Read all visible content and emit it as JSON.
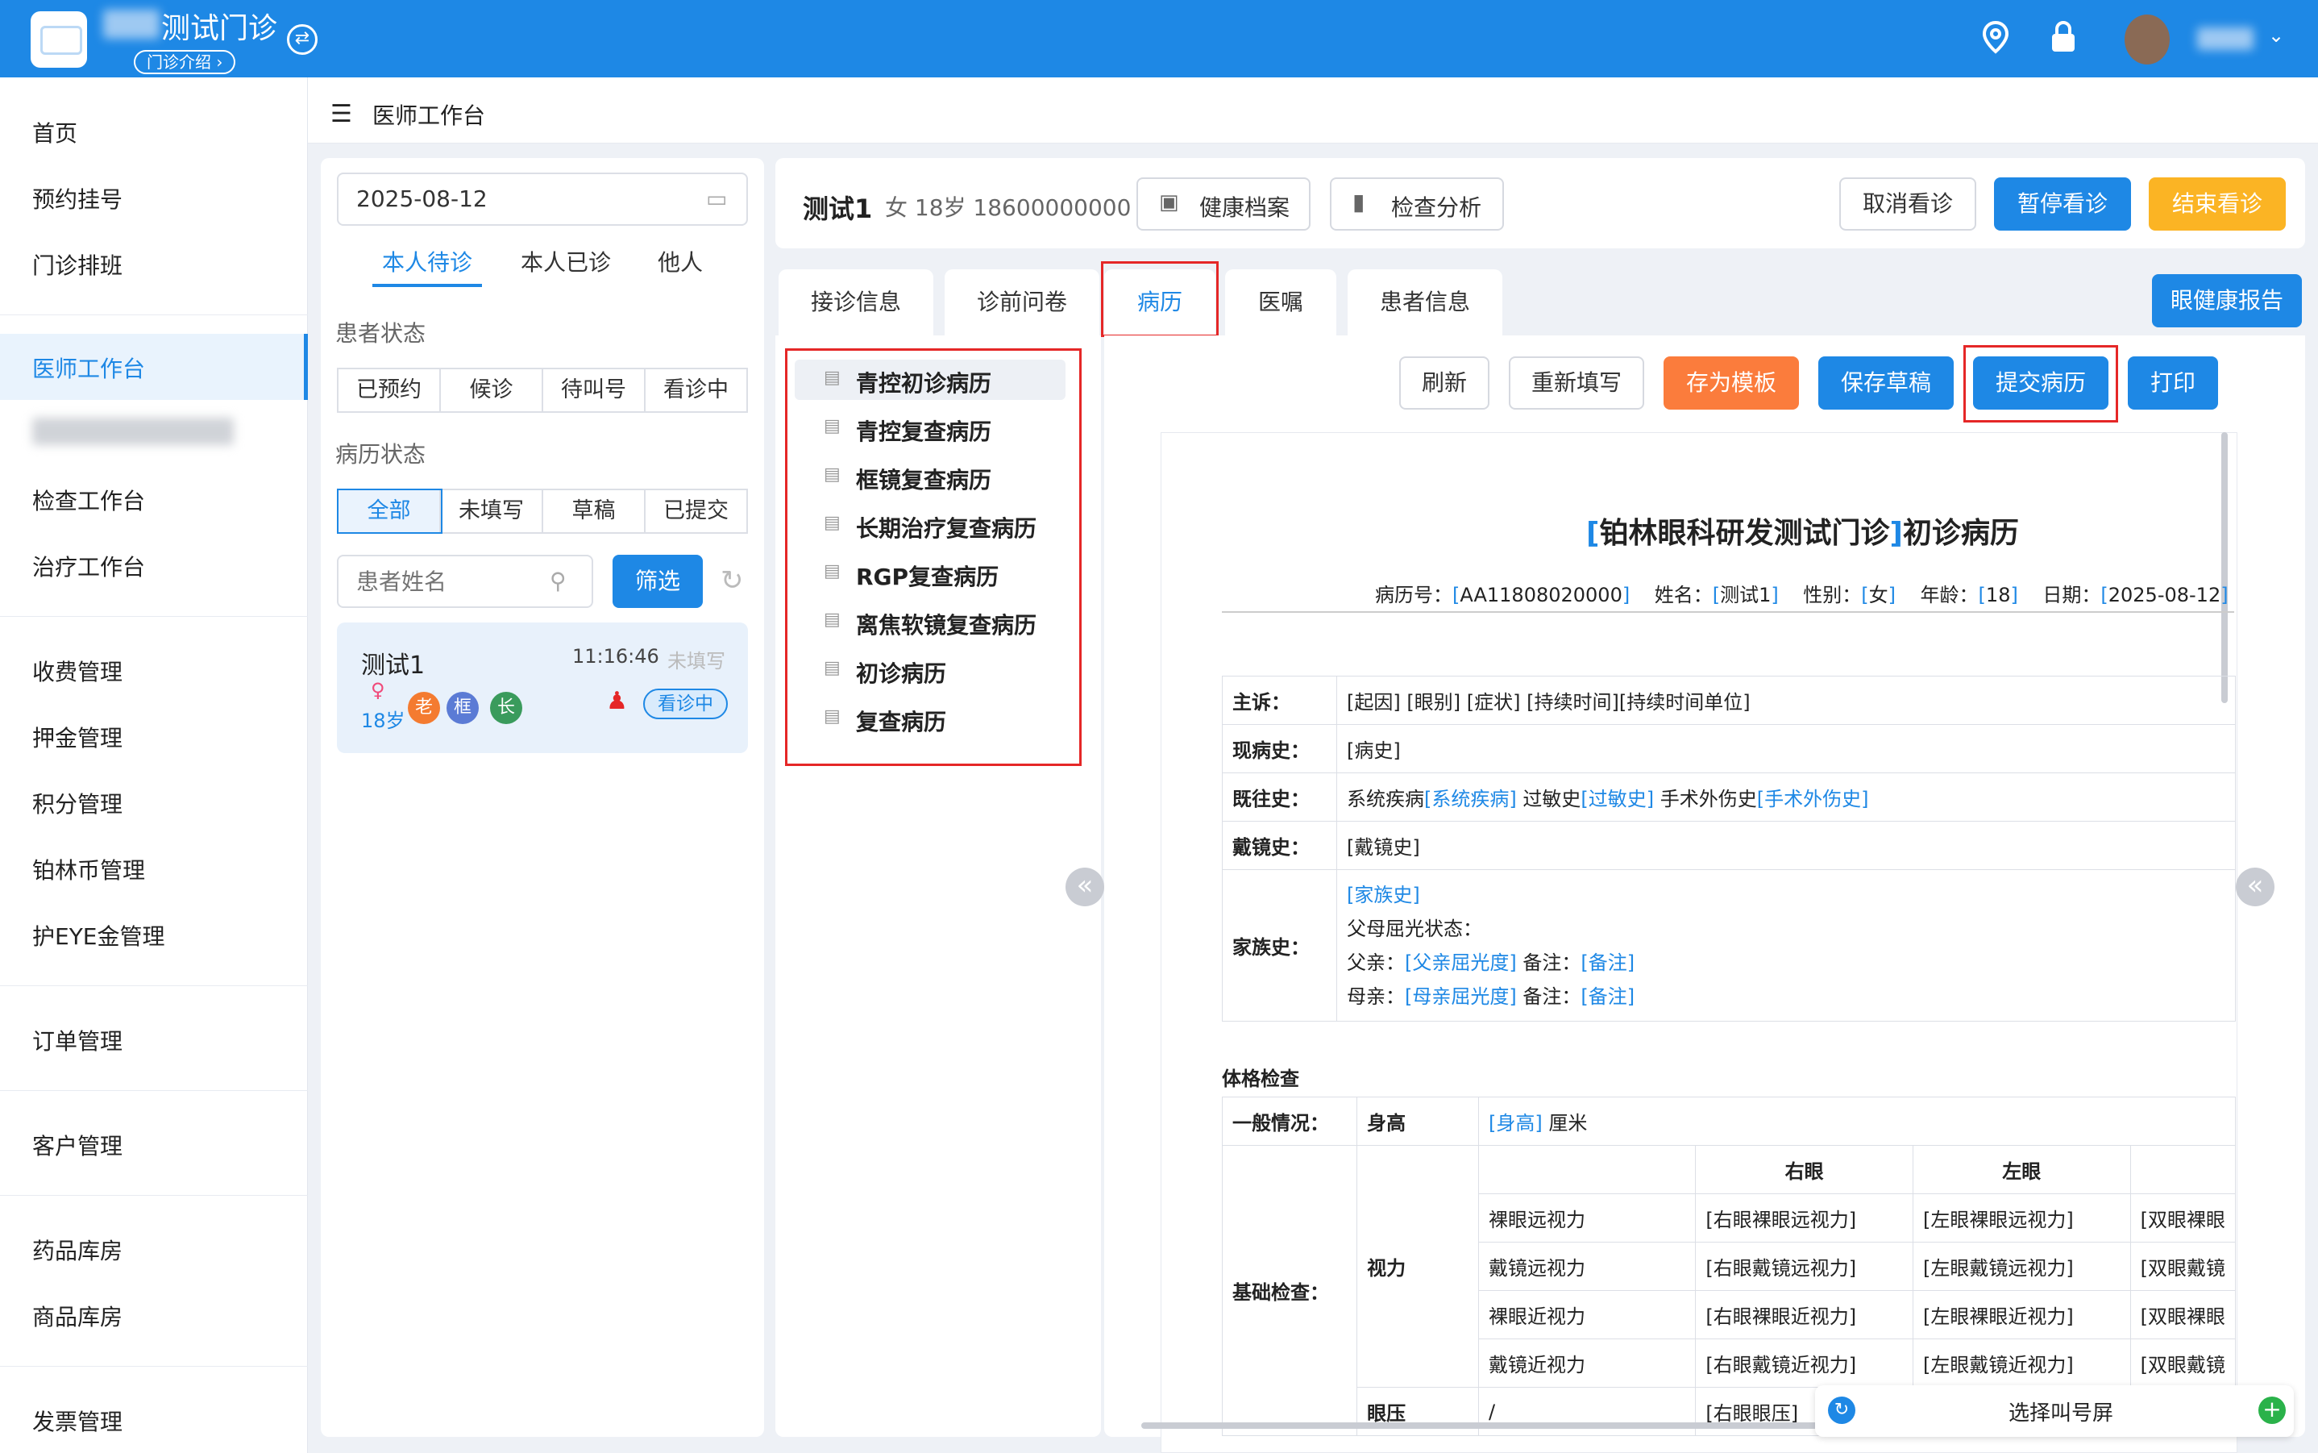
{
  "header": {
    "title": "测试门诊",
    "intro_link": "门诊介绍 ›",
    "icons": [
      "switch-icon",
      "location-icon",
      "lock-icon",
      "chevron-down-icon"
    ],
    "accent": "#1e88e5"
  },
  "sidebar": {
    "items": [
      "首页",
      "预约挂号",
      "门诊排班",
      "医师工作台",
      "检查工作台",
      "治疗工作台",
      "收费管理",
      "押金管理",
      "积分管理",
      "铂林币管理",
      "护EYE金管理",
      "订单管理",
      "客户管理",
      "药品库房",
      "商品库房",
      "发票管理"
    ],
    "active": "医师工作台"
  },
  "breadcrumb": {
    "title": "医师工作台"
  },
  "queue": {
    "date": "2025-08-12",
    "tabs": [
      "本人待诊",
      "本人已诊",
      "他人"
    ],
    "patient_status_label": "患者状态",
    "patient_status": [
      "已预约",
      "候诊",
      "待叫号",
      "看诊中"
    ],
    "record_status_label": "病历状态",
    "record_status": [
      "全部",
      "未填写",
      "草稿",
      "已提交"
    ],
    "search_placeholder": "患者姓名",
    "filter_button": "筛选",
    "patient": {
      "name": "测试1",
      "time": "11:16:46",
      "record_state": "未填写",
      "age": "18岁",
      "tags": [
        "老",
        "框",
        "长"
      ],
      "state": "看诊中"
    }
  },
  "patient_bar": {
    "name": "测试1",
    "info": "女 18岁 18600000000",
    "health_file": "健康档案",
    "exam_analysis": "检查分析",
    "cancel": "取消看诊",
    "pause": "暂停看诊",
    "finish": "结束看诊"
  },
  "tabs": [
    "接诊信息",
    "诊前问卷",
    "病历",
    "医嘱",
    "患者信息"
  ],
  "eye_report": "眼健康报告",
  "templates": [
    "青控初诊病历",
    "青控复查病历",
    "框镜复查病历",
    "长期治疗复查病历",
    "RGP复查病历",
    "离焦软镜复查病历",
    "初诊病历",
    "复查病历"
  ],
  "actions": {
    "refresh": "刷新",
    "refill": "重新填写",
    "save_template": "存为模板",
    "save_draft": "保存草稿",
    "submit": "提交病历",
    "print": "打印"
  },
  "record": {
    "title_org": "铂林眼科研发测试门诊",
    "title_suffix": "初诊病历",
    "meta": {
      "no_label": "病历号：",
      "no": "AA11808020000",
      "name_label": "姓名：",
      "name": "测试1",
      "sex_label": "性别：",
      "sex": "女",
      "age_label": "年龄：",
      "age": "18",
      "date_label": "日期：",
      "date": "2025-08-12"
    },
    "rows": {
      "complaint_label": "主诉：",
      "complaint": [
        "[起因]",
        "[眼别]",
        "[症状]",
        "[持续时间]",
        "[持续时间单位]"
      ],
      "present_label": "现病史：",
      "present": "[病史]",
      "past_label": "既往史：",
      "past": [
        "系统疾病",
        "[系统疾病]",
        "过敏史",
        "[过敏史]",
        "手术外伤史",
        "[手术外伤史]"
      ],
      "glasses_label": "戴镜史：",
      "glasses": "[戴镜史]",
      "family_label": "家族史：",
      "family": "[家族史]",
      "parent_state": "父母屈光状态：",
      "father": "父亲：",
      "father_ph": "[父亲屈光度]",
      "mother": "母亲：",
      "mother_ph": "[母亲屈光度]",
      "note": "备注：",
      "note_ph": "[备注]"
    },
    "physical": {
      "heading": "体格检查",
      "general": "一般情况：",
      "height": "身高",
      "height_ph": "[身高]",
      "height_unit": "厘米",
      "basic": "基础检查：",
      "vision": "视力",
      "right": "右眼",
      "left": "左眼",
      "vision_rows": [
        {
          "label": "裸眼远视力",
          "r": "[右眼裸眼远视力]",
          "l": "[左眼裸眼远视力]",
          "b": "[双眼裸眼"
        },
        {
          "label": "戴镜远视力",
          "r": "[右眼戴镜远视力]",
          "l": "[左眼戴镜远视力]",
          "b": "[双眼戴镜"
        },
        {
          "label": "裸眼近视力",
          "r": "[右眼裸眼近视力]",
          "l": "[左眼裸眼近视力]",
          "b": "[双眼裸眼"
        },
        {
          "label": "戴镜近视力",
          "r": "[右眼戴镜近视力]",
          "l": "[左眼戴镜近视力]",
          "b": "[双眼戴镜"
        }
      ],
      "iop": "眼压",
      "iop_val": "/",
      "iop_r": "[右眼眼压]"
    }
  },
  "call_screen": {
    "label": "选择叫号屏"
  }
}
